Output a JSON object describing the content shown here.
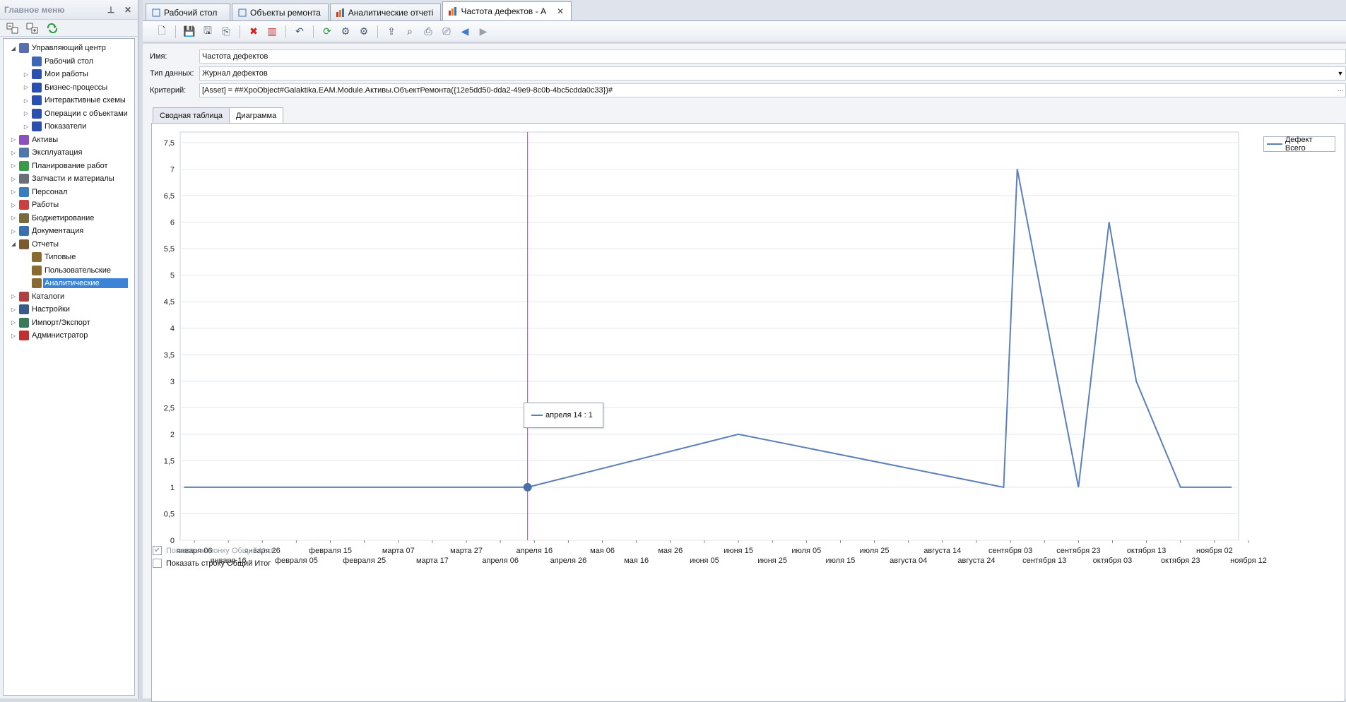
{
  "sidebar": {
    "title": "Главное меню",
    "pin_icon": "pin-icon",
    "close_icon": "close-icon",
    "toolbar": [
      "expand-all-icon",
      "collapse-all-icon",
      "refresh-icon"
    ],
    "tree": [
      {
        "label": "Управляющий центр",
        "level": 0,
        "expanded": true,
        "icon": "control-center-icon",
        "color": "#5a6fb0"
      },
      {
        "label": "Рабочий стол",
        "level": 1,
        "expanded": null,
        "icon": "desktop-icon",
        "color": "#3c67b8"
      },
      {
        "label": "Мои работы",
        "level": 1,
        "expanded": false,
        "icon": "book-icon",
        "color": "#2b4fb0"
      },
      {
        "label": "Бизнес-процессы",
        "level": 1,
        "expanded": false,
        "icon": "book-icon",
        "color": "#2b4fb0"
      },
      {
        "label": "Интерактивные схемы",
        "level": 1,
        "expanded": false,
        "icon": "book-icon",
        "color": "#2b4fb0"
      },
      {
        "label": "Операции с объектами",
        "level": 1,
        "expanded": false,
        "icon": "book-icon",
        "color": "#2b4fb0"
      },
      {
        "label": "Показатели",
        "level": 1,
        "expanded": false,
        "icon": "book-icon",
        "color": "#2b4fb0"
      },
      {
        "label": "Активы",
        "level": 0,
        "expanded": false,
        "icon": "assets-icon",
        "color": "#8b4fc0"
      },
      {
        "label": "Эксплуатация",
        "level": 0,
        "expanded": false,
        "icon": "operation-icon",
        "color": "#5077a8"
      },
      {
        "label": "Планирование работ",
        "level": 0,
        "expanded": false,
        "icon": "planning-icon",
        "color": "#3a9a4a"
      },
      {
        "label": "Запчасти и материалы",
        "level": 0,
        "expanded": false,
        "icon": "parts-icon",
        "color": "#6a6f78"
      },
      {
        "label": "Персонал",
        "level": 0,
        "expanded": false,
        "icon": "personnel-icon",
        "color": "#3a7cc0"
      },
      {
        "label": "Работы",
        "level": 0,
        "expanded": false,
        "icon": "works-icon",
        "color": "#c84040"
      },
      {
        "label": "Бюджетирование",
        "level": 0,
        "expanded": false,
        "icon": "budget-icon",
        "color": "#7a6a40"
      },
      {
        "label": "Документация",
        "level": 0,
        "expanded": false,
        "icon": "docs-icon",
        "color": "#3a6fb0"
      },
      {
        "label": "Отчеты",
        "level": 0,
        "expanded": true,
        "icon": "reports-icon",
        "color": "#7a5a30"
      },
      {
        "label": "Типовые",
        "level": 1,
        "expanded": null,
        "icon": "report-book-icon",
        "color": "#8a6a30"
      },
      {
        "label": "Пользовательские",
        "level": 1,
        "expanded": null,
        "icon": "report-book-icon",
        "color": "#8a6a30"
      },
      {
        "label": "Аналитические",
        "level": 1,
        "expanded": null,
        "icon": "report-book-icon",
        "color": "#8a6a30",
        "selected": true
      },
      {
        "label": "Каталоги",
        "level": 0,
        "expanded": false,
        "icon": "catalog-icon",
        "color": "#b04040"
      },
      {
        "label": "Настройки",
        "level": 0,
        "expanded": false,
        "icon": "settings-icon",
        "color": "#3a5a8a"
      },
      {
        "label": "Импорт/Экспорт",
        "level": 0,
        "expanded": false,
        "icon": "import-export-icon",
        "color": "#3a7a5a"
      },
      {
        "label": "Администратор",
        "level": 0,
        "expanded": false,
        "icon": "admin-icon",
        "color": "#c03030"
      }
    ]
  },
  "tabs": [
    {
      "label": "Рабочий стол",
      "icon": "desktop-icon"
    },
    {
      "label": "Объекты ремонта",
      "icon": "repair-object-icon"
    },
    {
      "label": "Аналитические отчеті",
      "icon": "bar-chart-icon"
    },
    {
      "label": "Частота дефектов - А",
      "icon": "bar-chart-icon",
      "active": true
    }
  ],
  "toolbar": [
    "new-icon",
    "save-icon",
    "save-as-icon",
    "copy-icon",
    "delete-icon",
    "chart-edit-icon",
    "undo-icon",
    "refresh-icon",
    "settings-1-icon",
    "settings-2-icon",
    "export-icon",
    "preview-icon",
    "print-icon",
    "print-setup-icon",
    "back-icon",
    "forward-icon"
  ],
  "form": {
    "name_label": "Имя:",
    "name_value": "Частота дефектов",
    "datatype_label": "Тип данных:",
    "datatype_value": "Журнал дефектов",
    "criteria_label": "Критерий:",
    "criteria_value": "[Asset] = ##XpoObject#Galaktika.EAM.Module.Активы.ОбъектРемонта({12e5dd50-dda2-49e9-8c0b-4bc5cdda0c33})#"
  },
  "inner_tabs": [
    {
      "label": "Сводная таблица"
    },
    {
      "label": "Диаграмма",
      "active": true
    }
  ],
  "legend": {
    "label": "Дефект Всего"
  },
  "tooltip": {
    "label": "апреля 14 : 1"
  },
  "checkboxes": [
    {
      "label": "Показать колонку Общий Итог",
      "checked": true,
      "disabled": true
    },
    {
      "label": "Показать строку Общий Итог",
      "checked": false,
      "disabled": false
    }
  ],
  "chart_data": {
    "type": "line",
    "title": "",
    "xlabel": "",
    "ylabel": "",
    "ylim": [
      0,
      7.7
    ],
    "y_ticks": [
      "0",
      "0,5",
      "1",
      "1,5",
      "2",
      "2,5",
      "3",
      "3,5",
      "4",
      "4,5",
      "5",
      "5,5",
      "6",
      "6,5",
      "7",
      "7,5"
    ],
    "x_tick_labels": [
      "января 06",
      "января 16",
      "января 26",
      "февраля 05",
      "февраля 15",
      "февраля 25",
      "марта 07",
      "марта 17",
      "марта 27",
      "апреля 06",
      "апреля 16",
      "апреля 26",
      "мая 06",
      "мая 16",
      "мая 26",
      "июня 05",
      "июня 15",
      "июня 25",
      "июля 05",
      "июля 15",
      "июля 25",
      "августа 04",
      "августа 14",
      "августа 24",
      "сентября 03",
      "сентября 13",
      "сентября 23",
      "октября 03",
      "октября 13",
      "октября 23",
      "ноября 02",
      "ноября 12"
    ],
    "x_start": "января 06",
    "x_step_days": 10,
    "series": [
      {
        "name": "Дефект Всего",
        "color": "#5b80b8",
        "points": [
          {
            "x": "января 03",
            "y": 1
          },
          {
            "x": "апреля 14",
            "y": 1
          },
          {
            "x": "июня 15",
            "y": 2
          },
          {
            "x": "сентября 01",
            "y": 1
          },
          {
            "x": "сентября 05",
            "y": 7
          },
          {
            "x": "сентября 23",
            "y": 1
          },
          {
            "x": "октября 02",
            "y": 6
          },
          {
            "x": "октября 10",
            "y": 3
          },
          {
            "x": "октября 23",
            "y": 1
          },
          {
            "x": "ноября 07",
            "y": 1
          }
        ]
      }
    ],
    "highlight": {
      "x": "апреля 14",
      "y": 1,
      "crosshair_color": "#b040c0"
    },
    "grid": true,
    "legend_position": "top-right"
  }
}
